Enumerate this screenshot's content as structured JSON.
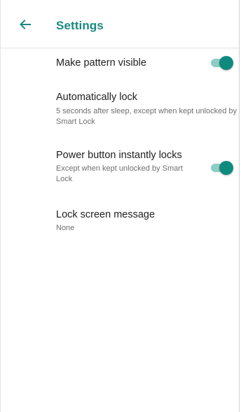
{
  "app_bar": {
    "title": "Settings",
    "back_icon": "arrow-left-icon"
  },
  "colors": {
    "accent": "#1a8a80",
    "toggle_thumb": "#0f8a7e",
    "toggle_track": "#8fccc5"
  },
  "settings": [
    {
      "title": "Make pattern visible",
      "summary": "",
      "toggle": true
    },
    {
      "title": "Automatically lock",
      "summary": "5 seconds after sleep, except when kept unlocked by Smart Lock"
    },
    {
      "title": "Power button instantly locks",
      "summary": "Except when kept unlocked by Smart Lock",
      "toggle": true
    },
    {
      "title": "Lock screen message",
      "summary": "None"
    }
  ]
}
